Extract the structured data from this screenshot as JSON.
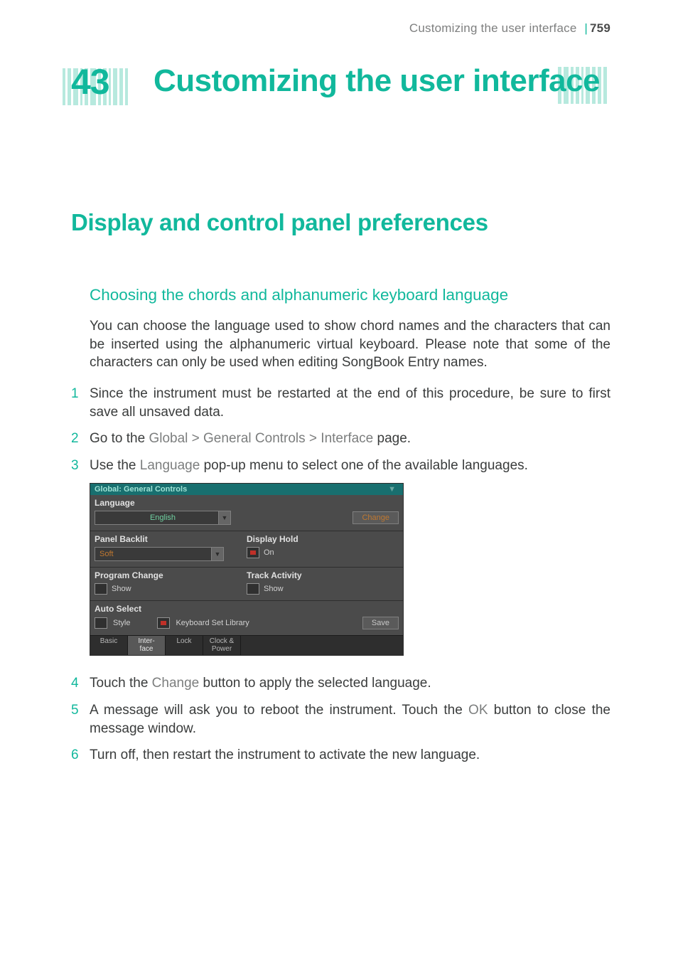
{
  "running_head": {
    "title": "Customizing the user interface",
    "page_number": "759"
  },
  "chapter": {
    "number": "43",
    "title": "Customizing the user interface"
  },
  "h2": "Display and control panel preferences",
  "h3": "Choosing the chords and alphanumeric keyboard language",
  "intro": "You can choose the language used to show chord names and the characters that can be inserted using the alphanumeric virtual keyboard. Please note that some of the characters can only be used when editing SongBook Entry names.",
  "steps": [
    {
      "n": "1",
      "t": "Since the instrument must be restarted at the end of this procedure, be sure to first save all unsaved data."
    },
    {
      "n": "2",
      "pre": "Go to the ",
      "path": "Global > General Controls > Interface",
      "post": " page."
    },
    {
      "n": "3",
      "pre": "Use the ",
      "path": "Language",
      "post": " pop-up menu to select one of the available languages."
    },
    {
      "n": "4",
      "pre": "Touch the ",
      "path": "Change",
      "post": " button to apply the selected language."
    },
    {
      "n": "5",
      "pre": "A message will ask you to reboot the instrument. Touch the ",
      "path": "OK",
      "post": " button to close the message window."
    },
    {
      "n": "6",
      "t": "Turn off, then restart the instrument to activate the new language."
    }
  ],
  "device": {
    "title": "Global: General Controls",
    "language_label": "Language",
    "language_value": "English",
    "change_btn": "Change",
    "panel_backlit_label": "Panel Backlit",
    "panel_backlit_value": "Soft",
    "display_hold_label": "Display Hold",
    "display_hold_value": "On",
    "program_change_label": "Program Change",
    "program_change_value": "Show",
    "track_activity_label": "Track Activity",
    "track_activity_value": "Show",
    "auto_select_label": "Auto Select",
    "auto_select_style": "Style",
    "auto_select_kbd": "Keyboard Set Library",
    "save_btn": "Save",
    "tabs": {
      "basic": "Basic",
      "interface_l1": "Inter-",
      "interface_l2": "face",
      "lock": "Lock",
      "clock_l1": "Clock &",
      "clock_l2": "Power"
    }
  }
}
